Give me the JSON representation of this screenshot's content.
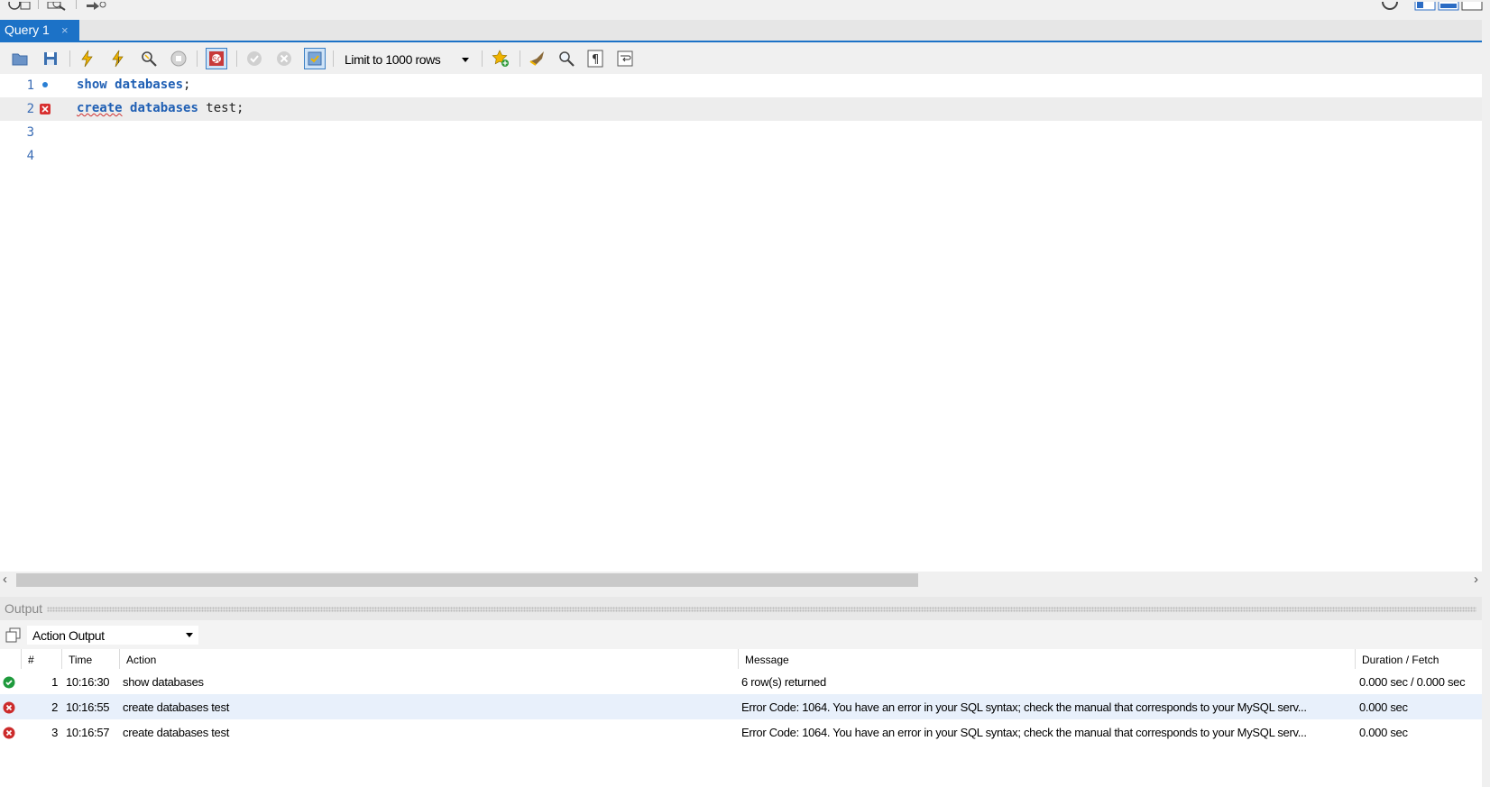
{
  "tab": {
    "label": "Query 1",
    "close": "×"
  },
  "toolbar": {
    "limit_select": "Limit to 1000 rows"
  },
  "editor": {
    "lines": [
      {
        "num": "1",
        "marker": "info-dot",
        "keyword1": "show",
        "keyword2": "databases",
        "rest": ";"
      },
      {
        "num": "2",
        "marker": "error",
        "keyword1": "create",
        "keyword2": "databases",
        "rest": " test;"
      },
      {
        "num": "3"
      },
      {
        "num": "4"
      }
    ]
  },
  "output": {
    "header_label": "Output",
    "select_value": "Action Output",
    "columns": [
      "#",
      "Time",
      "Action",
      "Message",
      "Duration / Fetch"
    ],
    "rows": [
      {
        "status": "ok",
        "num": "1",
        "time": "10:16:30",
        "action": "show databases",
        "message": "6 row(s) returned",
        "duration": "0.000 sec / 0.000 sec"
      },
      {
        "status": "error",
        "num": "2",
        "time": "10:16:55",
        "action": "create databases test",
        "message": "Error Code: 1064. You have an error in your SQL syntax; check the manual that corresponds to your MySQL serv...",
        "duration": "0.000 sec"
      },
      {
        "status": "error",
        "num": "3",
        "time": "10:16:57",
        "action": "create databases test",
        "message": "Error Code: 1064. You have an error in your SQL syntax; check the manual that corresponds to your MySQL serv...",
        "duration": "0.000 sec"
      }
    ]
  },
  "colors": {
    "accent": "#1c72c7",
    "keyword": "#1f5fb4",
    "ok": "#1e9a3c",
    "error": "#cc2b2b"
  }
}
